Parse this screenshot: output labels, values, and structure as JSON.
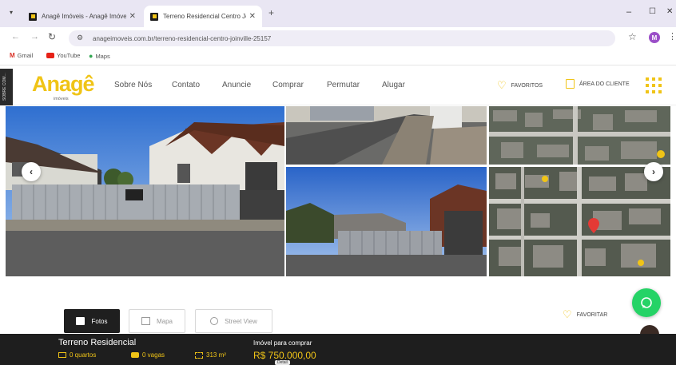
{
  "browser": {
    "tabs": [
      {
        "title": "Anagê Imóveis - Anagê Imóveis",
        "active": false
      },
      {
        "title": "Terreno Residencial Centro Joinville",
        "active": true
      }
    ],
    "new_tab_symbol": "+",
    "url": "anageimoveis.com.br/terreno-residencial-centro-joinville-25157",
    "profile_initial": "M",
    "bookmarks": [
      "Gmail",
      "YouTube",
      "Maps"
    ],
    "window_controls": [
      "–",
      "☐",
      "✕"
    ]
  },
  "site": {
    "side_tab_label": "SOBRE COM...",
    "logo": {
      "wordmark": "Anagê",
      "subtext": "imóveis"
    },
    "nav": [
      "Sobre Nós",
      "Contato",
      "Anuncie",
      "Comprar",
      "Permutar",
      "Alugar"
    ],
    "favorites_label": "FAVORITOS",
    "client_area_label": "ÁREA DO CLIENTE",
    "brand_color": "#f0c417"
  },
  "gallery": {
    "prev_symbol": "‹",
    "next_symbol": "›"
  },
  "view_tabs": [
    {
      "label": "Fotos",
      "icon": "photo-icon",
      "active": true
    },
    {
      "label": "Mapa",
      "icon": "map-icon",
      "active": false
    },
    {
      "label": "Street View",
      "icon": "street-view-icon",
      "active": false
    }
  ],
  "favoritar_label": "FAVORITAR",
  "whatsapp_color": "#25d366",
  "listing": {
    "title": "Terreno Residencial",
    "purpose": "Imóvel para comprar",
    "price": "R$ 750.000,00",
    "features": [
      {
        "icon": "bed-icon",
        "label": "0 quartos"
      },
      {
        "icon": "car-icon",
        "label": "0 vagas"
      },
      {
        "icon": "area-icon",
        "label": "313 m²"
      }
    ],
    "price_tooltip": "Detail"
  }
}
